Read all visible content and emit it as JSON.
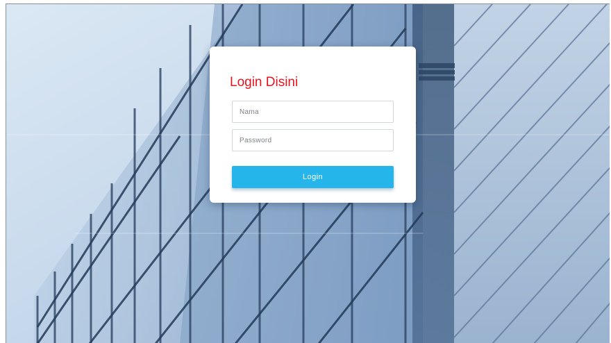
{
  "login_card": {
    "title": "Login Disini",
    "name_field": {
      "placeholder": "Nama",
      "value": ""
    },
    "password_field": {
      "placeholder": "Password",
      "value": ""
    },
    "submit_label": "Login"
  },
  "colors": {
    "title": "#e5141f",
    "button": "#26b5ea",
    "card_background": "#ffffff",
    "backdrop_sky": "#cfe0ef",
    "backdrop_glass": "#6f8fb2"
  },
  "background": {
    "subject": "glass office building facade"
  }
}
